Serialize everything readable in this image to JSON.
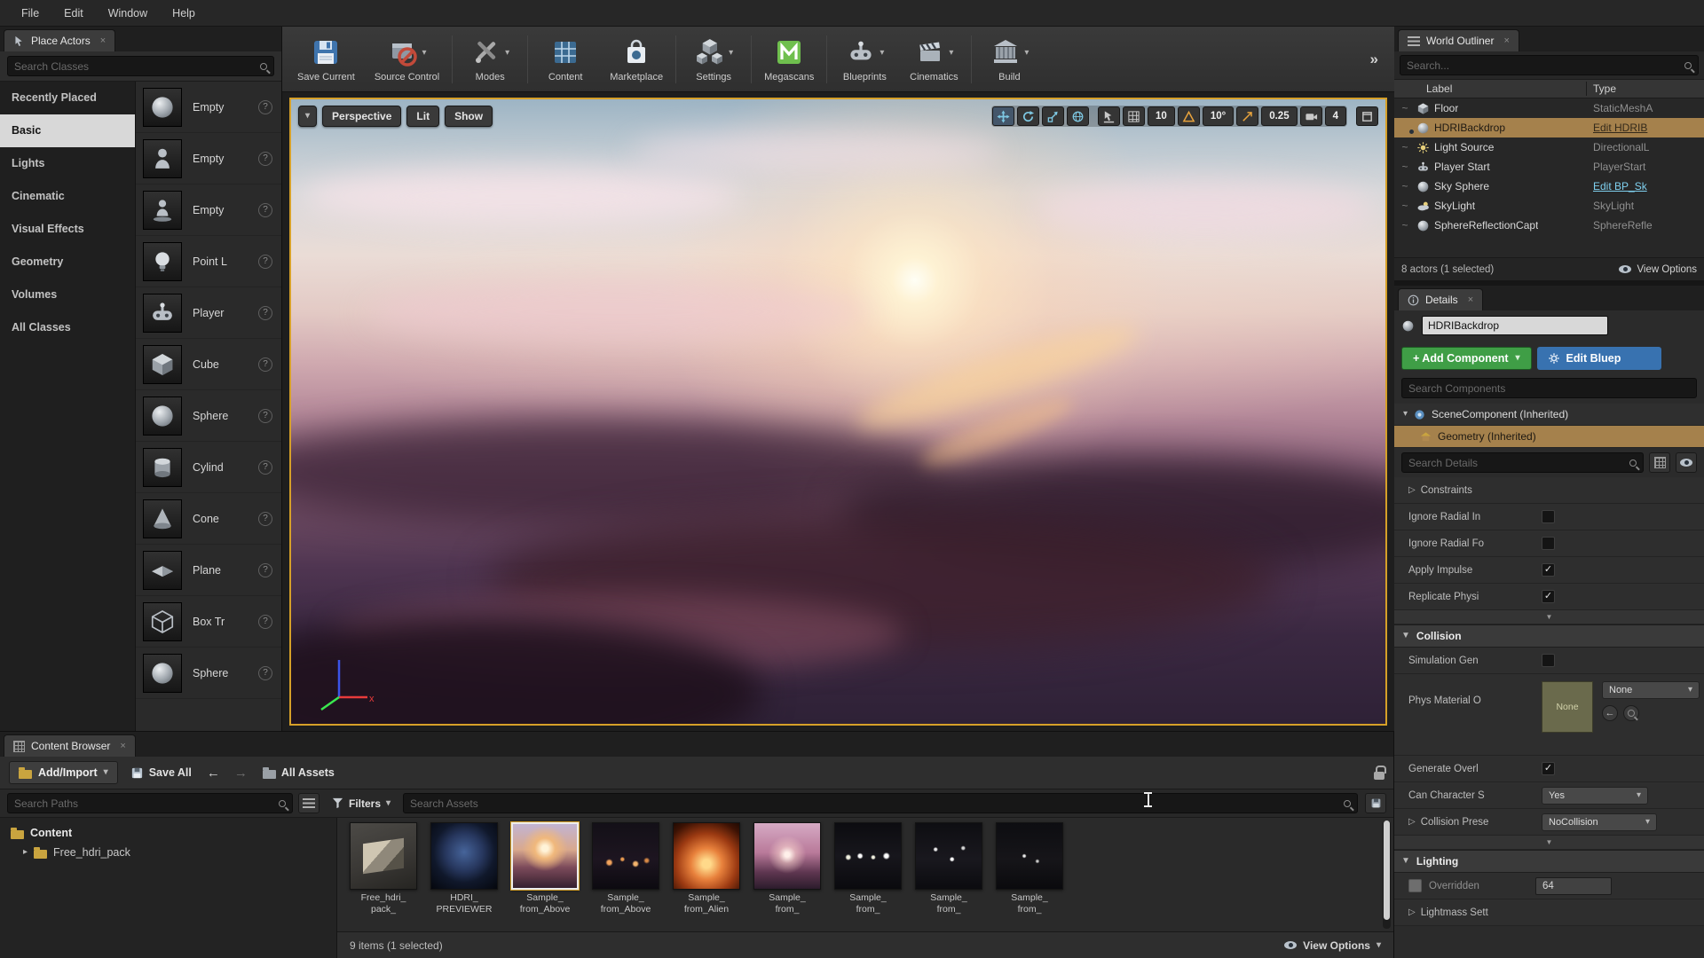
{
  "glyphs": {
    "caret_down": "▾",
    "caret_right": "▸",
    "tri_down": "▼",
    "tri_right": "▷",
    "close": "×",
    "check": "✓",
    "back": "←",
    "forward": "→",
    "overflow": "»",
    "marker": "~",
    "help": "?"
  },
  "colors": {
    "selection_tan": "#a5814c",
    "viewport_border": "#d6a028",
    "add_component_green": "#3f9e46",
    "edit_blueprint_blue": "#3872b0",
    "megascans_green": "#6fbf4e",
    "link_blue": "#7fd1f0"
  },
  "menu": {
    "items": [
      "File",
      "Edit",
      "Window",
      "Help"
    ]
  },
  "place_actors": {
    "title": "Place Actors",
    "search_placeholder": "Search Classes",
    "categories": [
      {
        "label": "Recently Placed"
      },
      {
        "label": "Basic"
      },
      {
        "label": "Lights"
      },
      {
        "label": "Cinematic"
      },
      {
        "label": "Visual Effects"
      },
      {
        "label": "Geometry"
      },
      {
        "label": "Volumes"
      },
      {
        "label": "All Classes"
      }
    ],
    "actors": [
      {
        "label": "Empty"
      },
      {
        "label": "Empty"
      },
      {
        "label": "Empty"
      },
      {
        "label": "Point L"
      },
      {
        "label": "Player"
      },
      {
        "label": "Cube"
      },
      {
        "label": "Sphere"
      },
      {
        "label": "Cylind"
      },
      {
        "label": "Cone"
      },
      {
        "label": "Plane"
      },
      {
        "label": "Box Tr"
      },
      {
        "label": "Sphere"
      }
    ]
  },
  "toolbar": {
    "save_current": "Save Current",
    "source_control": "Source Control",
    "modes": "Modes",
    "content": "Content",
    "marketplace": "Marketplace",
    "settings": "Settings",
    "megascans": "Megascans",
    "blueprints": "Blueprints",
    "cinematics": "Cinematics",
    "build": "Build"
  },
  "viewport": {
    "perspective": "Perspective",
    "lit": "Lit",
    "show": "Show",
    "grid_snap": "10",
    "angle_snap": "10°",
    "scale_snap": "0.25",
    "camera_speed": "4",
    "axis_x": "x"
  },
  "world_outliner": {
    "title": "World Outliner",
    "search_placeholder": "Search...",
    "col_label": "Label",
    "col_type": "Type",
    "rows": [
      {
        "label": "Floor",
        "type": "StaticMeshA"
      },
      {
        "label": "HDRIBackdrop",
        "type": "Edit HDRIB"
      },
      {
        "label": "Light Source",
        "type": "DirectionalL"
      },
      {
        "label": "Player Start",
        "type": "PlayerStart"
      },
      {
        "label": "Sky Sphere",
        "type": "Edit BP_Sk"
      },
      {
        "label": "SkyLight",
        "type": "SkyLight"
      },
      {
        "label": "SphereReflectionCapt",
        "type": "SphereRefle"
      }
    ],
    "footer": "8 actors (1 selected)",
    "view_options": "View Options"
  },
  "details": {
    "title": "Details",
    "name_value": "HDRIBackdrop",
    "add_component": "+ Add Component",
    "edit_blueprint": "Edit Bluep",
    "search_components_placeholder": "Search Components",
    "component_rows": [
      {
        "label": "SceneComponent (Inherited)"
      },
      {
        "label": "Geometry (Inherited)"
      }
    ],
    "search_details_placeholder": "Search Details",
    "props": {
      "constraints": "Constraints",
      "ignore_radial_in": "Ignore Radial In",
      "ignore_radial_fo": "Ignore Radial Fo",
      "apply_impulse": "Apply Impulse",
      "replicate_physi": "Replicate Physi",
      "collision_section": "Collision",
      "simulation_gen": "Simulation Gen",
      "phys_material": "Phys Material O",
      "phys_material_thumb": "None",
      "phys_material_value": "None",
      "generate_overl": "Generate Overl",
      "can_character": "Can Character S",
      "can_character_value": "Yes",
      "collision_prese": "Collision Prese",
      "collision_prese_value": "NoCollision",
      "lighting_section": "Lighting",
      "overridden": "Overridden",
      "overridden_value": "64",
      "lightmass": "Lightmass Sett"
    }
  },
  "content_browser": {
    "title": "Content Browser",
    "add_import": "Add/Import",
    "save_all": "Save All",
    "path": "All Assets",
    "search_paths_placeholder": "Search Paths",
    "filters": "Filters",
    "search_assets_placeholder": "Search Assets",
    "tree": [
      {
        "label": "Content"
      },
      {
        "label": "Free_hdri_pack"
      }
    ],
    "assets": [
      {
        "line1": "Free_hdri_",
        "line2": "pack_"
      },
      {
        "line1": "HDRI_",
        "line2": "PREVIEWER"
      },
      {
        "line1": "Sample_",
        "line2": "from_Above"
      },
      {
        "line1": "Sample_",
        "line2": "from_Above"
      },
      {
        "line1": "Sample_",
        "line2": "from_Alien"
      },
      {
        "line1": "Sample_",
        "line2": "from_"
      },
      {
        "line1": "Sample_",
        "line2": "from_"
      },
      {
        "line1": "Sample_",
        "line2": "from_"
      },
      {
        "line1": "Sample_",
        "line2": "from_"
      }
    ],
    "footer": "9 items (1 selected)",
    "view_options": "View Options"
  }
}
